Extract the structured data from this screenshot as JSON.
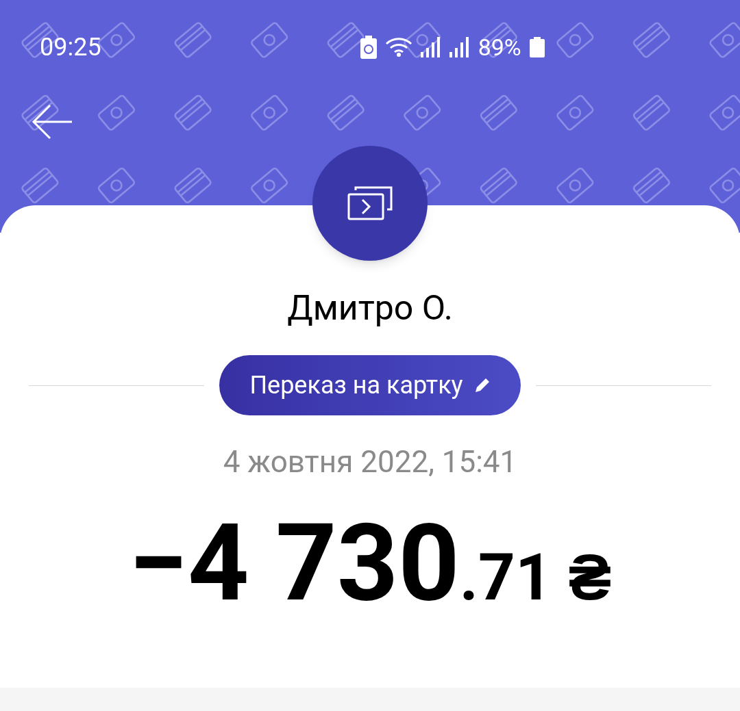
{
  "status_bar": {
    "time": "09:25",
    "battery": "89%"
  },
  "transaction": {
    "name": "Дмитро О.",
    "category": "Переказ на картку",
    "date": "4 жовтня 2022, 15:41",
    "amount_main": "−4 730",
    "amount_fraction": ".71",
    "currency": "₴"
  }
}
